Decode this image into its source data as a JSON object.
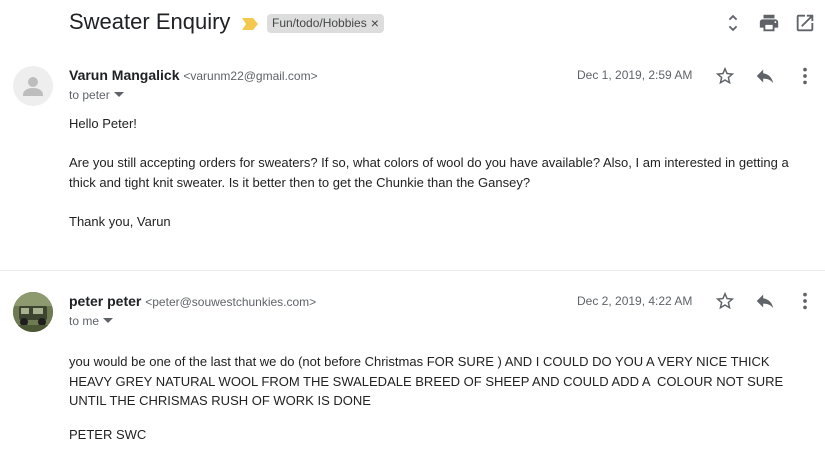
{
  "header": {
    "subject": "Sweater Enquiry",
    "label": "Fun/todo/Hobbies",
    "label_remove": "×",
    "icons": [
      "expand-all-icon",
      "print-icon",
      "open-in-new-window-icon"
    ]
  },
  "messages": [
    {
      "sender_name": "Varun Mangalick",
      "sender_email": "<varunm22@gmail.com>",
      "recipient": "to peter",
      "date": "Dec 1, 2019, 2:59 AM",
      "body": [
        "Hello Peter!",
        "Are you still accepting orders for sweaters? If so, what colors of wool do you have available? Also, I am interested in getting a thick and tight knit sweater. Is it better then to get the Chunkie than the Gansey?",
        "Thank you, Varun"
      ]
    },
    {
      "sender_name": "peter peter",
      "sender_email": "<peter@souwestchunkies.com>",
      "recipient": "to me",
      "date": "Dec 2, 2019, 4:22 AM",
      "body": [
        "you would be one of the last that we do (not before Christmas FOR SURE ) AND I COULD DO YOU A VERY NICE THICK HEAVY GREY NATURAL WOOL FROM THE SWALEDALE BREED OF SHEEP AND COULD ADD A  COLOUR NOT SURE UNTIL THE CHRISMAS RUSH OF WORK IS DONE",
        "PETER SWC"
      ]
    }
  ],
  "colors": {
    "importance_marker": "#f2c94c",
    "label_bg": "#dddddd",
    "icon_gray": "#5f6368"
  }
}
